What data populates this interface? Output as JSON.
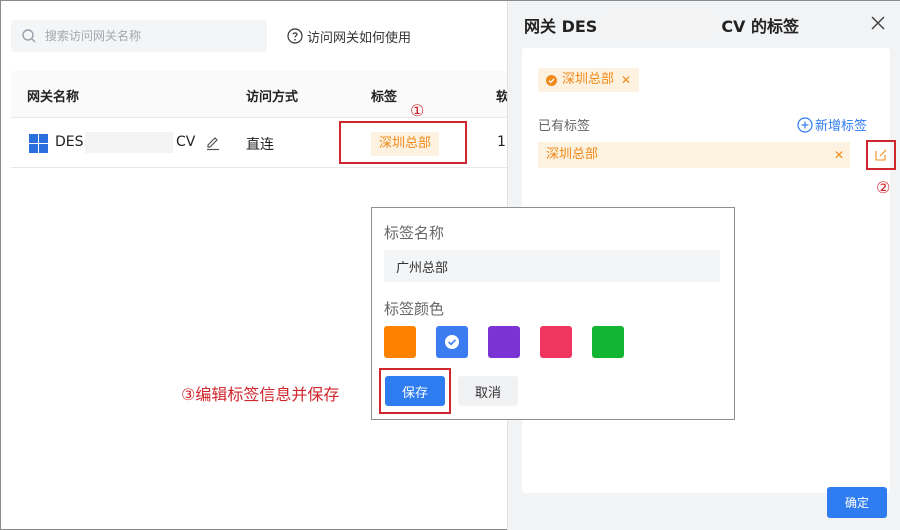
{
  "search": {
    "placeholder": "搜索访问网关名称"
  },
  "help_link": {
    "label": "访问网关如何使用"
  },
  "table": {
    "columns": [
      "网关名称",
      "访问方式",
      "标签",
      "软"
    ],
    "rows": [
      {
        "name_prefix": "DES",
        "name_suffix": "CV",
        "access": "直连",
        "tag": "深圳总部",
        "extra": "1"
      }
    ]
  },
  "annotations": {
    "a1": "①",
    "a2": "②",
    "a3": "③编辑标签信息并保存"
  },
  "popover": {
    "name_label": "标签名称",
    "name_value": "广州总部",
    "color_label": "标签颜色",
    "colors": [
      "#ff8100",
      "#3c7cf0",
      "#7b33d6",
      "#f0365f",
      "#12b532"
    ],
    "selected_color_index": 1,
    "save_label": "保存",
    "cancel_label": "取消"
  },
  "drawer": {
    "title_prefix": "网关 DES",
    "title_suffix": "CV 的标签",
    "selected_tag": "深圳总部",
    "existing_label": "已有标签",
    "add_label": "新增标签",
    "existing_tags": [
      {
        "label": "深圳总部"
      }
    ],
    "confirm_label": "确定"
  },
  "colors": {
    "tag_text": "#f08a1a",
    "tag_bg": "#fdf1e0",
    "primary": "#2f7cf0",
    "annotation": "#d0262d"
  }
}
